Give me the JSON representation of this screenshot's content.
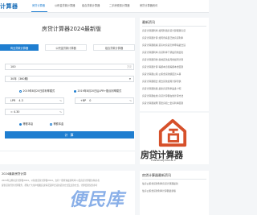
{
  "header": {
    "logo": "计算器",
    "nav": [
      "房贷计算器",
      "公积金贷款计算器",
      "组合贷款计算器",
      "二手房税费计算器",
      "房贷计算器资讯"
    ]
  },
  "main": {
    "title": "房贷计算器2024最新版",
    "tabs": [
      "商业贷款计算器",
      "公积金贷款计算器",
      "组合贷款计算器"
    ],
    "amount": {
      "value": "100",
      "unit": "万元"
    },
    "term": {
      "value": "30年（360期）"
    },
    "radios": [
      "2019年8月20日前利率模式",
      "2019年8月20日后LPR+基点利率模式"
    ],
    "lpr": {
      "label": "LPR",
      "value": "4.3",
      "unit": "%"
    },
    "bp": {
      "label": "+BP",
      "value": "0",
      "unit": "%"
    },
    "rate": {
      "value": "= 4.30",
      "unit": "%"
    },
    "repay": [
      "等额本息",
      "等额本金"
    ],
    "calc_label": "计 算"
  },
  "sidebar": {
    "title": "最新资讯",
    "items": [
      "房贷计算器利率 如何利用房贷计算器算房贷",
      "房贷计算器计算 如何查看自己的房贷利率",
      "房贷计算器按揭 买房时房贷怎样申请最合适",
      "房贷计算器利率 房贷利率下调后月供变化",
      "房贷计算器月供 提前还款后月供如何计算",
      "房贷计算器计算 等额本息和等额本金区别",
      "房贷计算器公积 公积金贷款额度怎么算",
      "房贷计算器组合 组合贷款如何计算月供",
      "房贷计算器新版 最新房贷利率是多少呢",
      "房贷计算器在线 房贷计算器在线计算方法",
      "房贷计算器说明 首套房和二套房利率区别"
    ]
  },
  "ad": {
    "name": "房贷计算器",
    "domain": "FANGDAIJISUAN.C",
    "colors": {
      "house": "#d6502a"
    }
  },
  "intro": {
    "title": "2024最新房贷计算",
    "lines": [
      "2024年又称房贷计算器2024，公积金贷款计算器2024，支持一键查询最新利率 以及房贷计算器为购房者",
      "提供贷款月供计算服务，帮助广大用户根据自身情况选择合适的贷款方式及还款方式。计算结果仅供参考"
    ]
  },
  "side2": {
    "title": "房贷计算器最新资讯",
    "items": [
      "住房公积金贷款利率房贷计算器最新",
      "住房公积金贷款利率计算器最新版"
    ]
  },
  "watermark": "便民库"
}
